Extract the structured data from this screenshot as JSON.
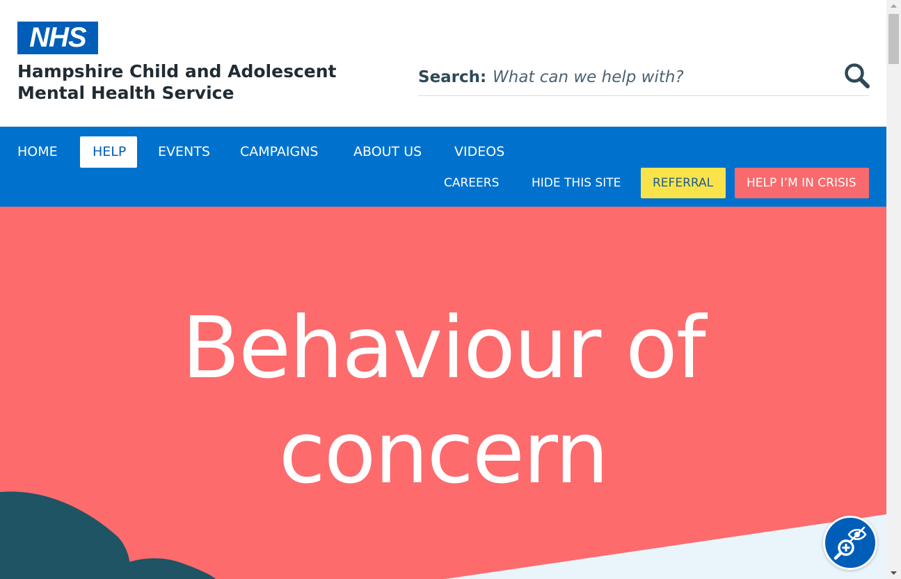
{
  "header": {
    "logo_text": "NHS",
    "org_name": "Hampshire Child and Adolescent Mental Health Service",
    "search": {
      "label": "Search:",
      "placeholder": "What can we help with?",
      "button_icon": "search-icon"
    }
  },
  "nav": {
    "primary": [
      {
        "label": "HOME",
        "active": false
      },
      {
        "label": "HELP",
        "active": true
      },
      {
        "label": "EVENTS",
        "active": false
      },
      {
        "label": "CAMPAIGNS",
        "active": false
      },
      {
        "label": "ABOUT US",
        "active": false
      },
      {
        "label": "VIDEOS",
        "active": false
      }
    ],
    "secondary": [
      {
        "label": "CAREERS"
      },
      {
        "label": "HIDE THIS SITE"
      },
      {
        "label": "REFERRAL"
      },
      {
        "label": "HELP I’M IN CRISIS"
      }
    ]
  },
  "hero": {
    "title_line1": "Behaviour of",
    "title_line2": "concern"
  },
  "accessibility_widget": {
    "icon": "accessibility-magnifier-icon"
  },
  "colors": {
    "nhs_blue": "#005eb8",
    "nav_blue": "#0072ce",
    "hero_coral": "#fd6b6d",
    "referral_yellow": "#fae34a",
    "crisis_red": "#f86a6d",
    "text_dark": "#212b32"
  }
}
